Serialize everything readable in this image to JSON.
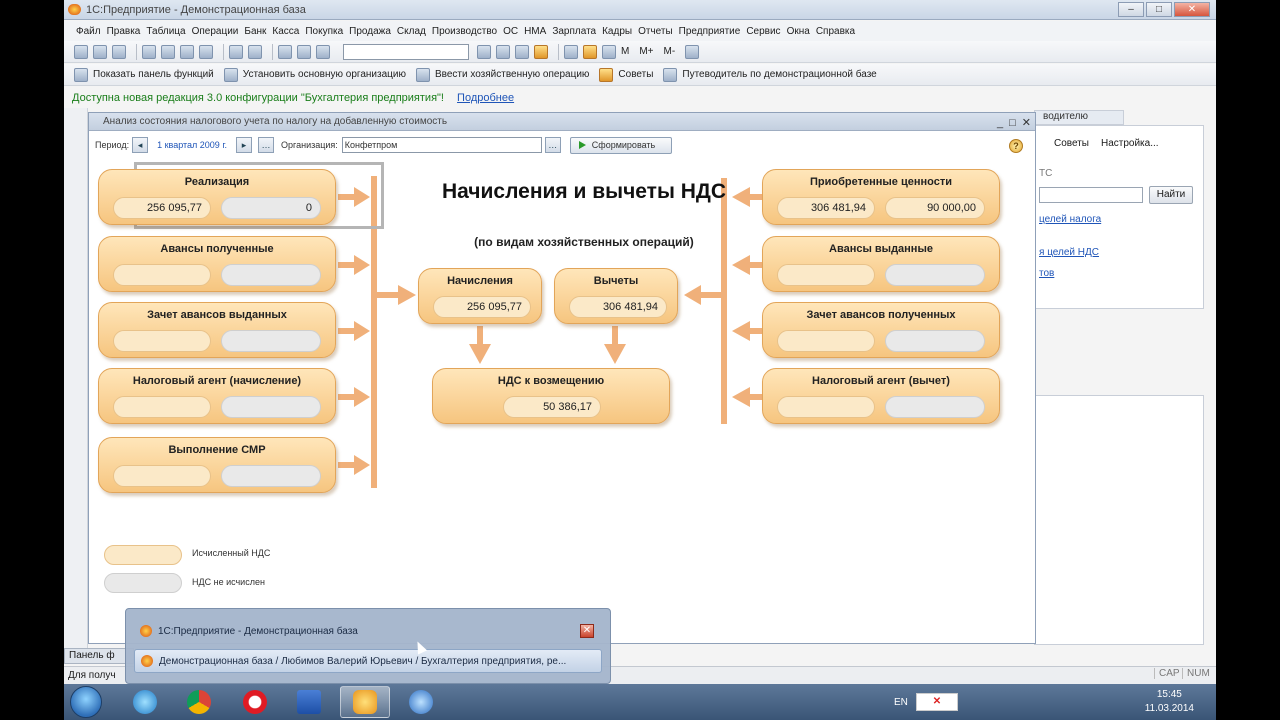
{
  "window": {
    "title": "1С:Предприятие - Демонстрационная база"
  },
  "menu": [
    "Файл",
    "Правка",
    "Таблица",
    "Операции",
    "Банк",
    "Касса",
    "Покупка",
    "Продажа",
    "Склад",
    "Производство",
    "ОС",
    "НМА",
    "Зарплата",
    "Кадры",
    "Отчеты",
    "Предприятие",
    "Сервис",
    "Окна",
    "Справка"
  ],
  "toolbar2": {
    "show_panel": "Показать панель функций",
    "set_org": "Установить основную организацию",
    "enter_op": "Ввести хозяйственную операцию",
    "tips": "Советы",
    "guide": "Путеводитель по демонстрационной базе"
  },
  "toolbar1": {
    "m1": "M",
    "m2": "M+",
    "m3": "M-"
  },
  "notice": {
    "text": "Доступна новая редакция 3.0 конфигурации \"Бухгалтерия предприятия\"!",
    "link": "Подробнее"
  },
  "bg": {
    "tab": "водителю",
    "tips": "Советы",
    "settings": "Настройка...",
    "find": "Найти",
    "frag1": "ТС",
    "link1": "целей налога",
    "link2": "я целей НДС",
    "link3": "тов"
  },
  "dialog": {
    "title": "Анализ состояния налогового учета по налогу на добавленную стоимость",
    "period_label": "Период:",
    "period_value": "1 квартал 2009 г.",
    "org_label": "Организация:",
    "org_value": "Конфетпром",
    "build_button": "Сформировать",
    "help": "?"
  },
  "diagram": {
    "title": "Начисления и вычеты НДС",
    "subtitle": "(по видам хозяйственных операций)",
    "left_cards": [
      {
        "label": "Реализация",
        "v1": "256 095,77",
        "v2": "0"
      },
      {
        "label": "Авансы полученные",
        "v1": "",
        "v2": ""
      },
      {
        "label": "Зачет авансов выданных",
        "v1": "",
        "v2": ""
      },
      {
        "label": "Налоговый агент (начисление)",
        "v1": "",
        "v2": ""
      },
      {
        "label": "Выполнение СМР",
        "v1": "",
        "v2": ""
      }
    ],
    "right_cards": [
      {
        "label": "Приобретенные ценности",
        "v1": "306 481,94",
        "v2": "90 000,00"
      },
      {
        "label": "Авансы выданные",
        "v1": "",
        "v2": ""
      },
      {
        "label": "Зачет авансов полученных",
        "v1": "",
        "v2": ""
      },
      {
        "label": "Налоговый агент (вычет)",
        "v1": "",
        "v2": ""
      }
    ],
    "accrual": {
      "label": "Начисления",
      "value": "256 095,77"
    },
    "deduction": {
      "label": "Вычеты",
      "value": "306 481,94"
    },
    "refund": {
      "label": "НДС к возмещению",
      "value": "50 386,17"
    }
  },
  "legend": {
    "calculated": "Исчисленный НДС",
    "not_calculated": "НДС не исчислен"
  },
  "statusbar": {
    "panel": "Панель ф",
    "hint": "Для получ",
    "cap": "CAP",
    "num": "NUM"
  },
  "preview": {
    "row1": "1С:Предприятие - Демонстрационная база",
    "row2": "Демонстрационная база / Любимов Валерий Юрьевич / Бухгалтерия предприятия, ре..."
  },
  "taskbar": {
    "lang": "EN",
    "time": "15:45",
    "date": "11.03.2014"
  },
  "colors": {
    "card": "#f6c57f",
    "arrow": "#f0b07a",
    "link": "#1f55b8",
    "notice": "#1a7e1a"
  }
}
